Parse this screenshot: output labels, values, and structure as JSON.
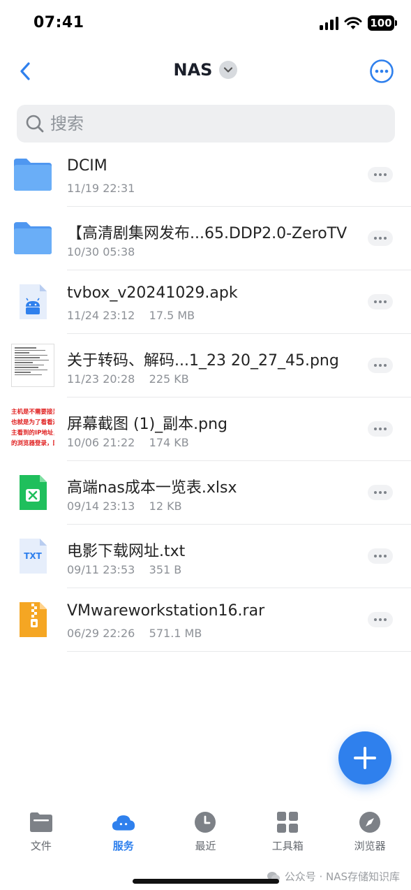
{
  "status_bar": {
    "time": "07:41",
    "battery": "100"
  },
  "header": {
    "title": "NAS"
  },
  "search": {
    "placeholder": "搜索"
  },
  "files": [
    {
      "name": "DCIM",
      "date": "11/19 22:31",
      "size": "",
      "icon": "folder-icon"
    },
    {
      "name": "【高清剧集网发布...65.DDP2.0-ZeroTV",
      "date": "10/30 05:38",
      "size": "",
      "icon": "folder-icon"
    },
    {
      "name": "tvbox_v20241029.apk",
      "date": "11/24 23:12",
      "size": "17.5 MB",
      "icon": "android-apk-icon"
    },
    {
      "name": "关于转码、解码...1_23 20_27_45.png",
      "date": "11/23 20:28",
      "size": "225 KB",
      "icon": "image-thumbnail"
    },
    {
      "name": "屏幕截图 (1)_副本.png",
      "date": "10/06 21:22",
      "size": "174 KB",
      "icon": "image-thumbnail",
      "thumb_text": [
        "主机是不需要接显示器",
        "也就是为了看看这台电",
        "主看到的IP地址，用局",
        "的浏览器登录，即可访"
      ]
    },
    {
      "name": "高端nas成本一览表.xlsx",
      "date": "09/14 23:13",
      "size": "12 KB",
      "icon": "excel-icon"
    },
    {
      "name": "电影下载网址.txt",
      "date": "09/11 23:53",
      "size": "351 B",
      "icon": "txt-icon",
      "icon_label": "TXT"
    },
    {
      "name": "VMwareworkstation16.rar",
      "date": "06/29 22:26",
      "size": "571.1 MB",
      "icon": "archive-icon"
    }
  ],
  "tabs": [
    {
      "label": "文件",
      "icon": "folder-tab-icon",
      "active": false
    },
    {
      "label": "服务",
      "icon": "cloud-tab-icon",
      "active": true
    },
    {
      "label": "最近",
      "icon": "clock-tab-icon",
      "active": false
    },
    {
      "label": "工具箱",
      "icon": "grid-tab-icon",
      "active": false
    },
    {
      "label": "浏览器",
      "icon": "compass-tab-icon",
      "active": false
    }
  ],
  "watermark": "公众号 · NAS存储知识库",
  "colors": {
    "accent": "#2f80ed",
    "folder": "#5aa2f5",
    "excel": "#1fbf5c",
    "archive": "#f5a623"
  }
}
